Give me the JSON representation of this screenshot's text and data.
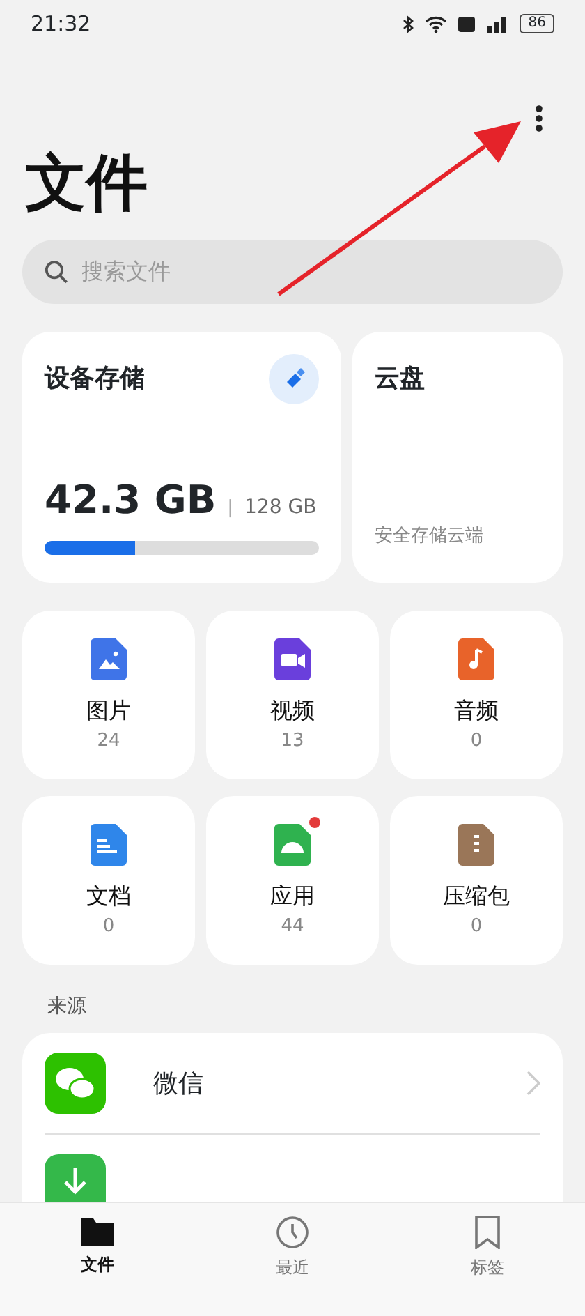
{
  "status_bar": {
    "time": "21:32",
    "battery": "86"
  },
  "title": "文件",
  "search": {
    "placeholder": "搜索文件"
  },
  "storage": {
    "title": "设备存储",
    "used": "42.3 GB",
    "separator": "|",
    "total": "128 GB",
    "level": 0.33
  },
  "cloud": {
    "title": "云盘",
    "subtitle": "安全存储云端"
  },
  "categories": [
    {
      "label": "图片",
      "count": "24",
      "kind": "image",
      "color": "#3f74e8"
    },
    {
      "label": "视频",
      "count": "13",
      "kind": "video",
      "color": "#6a3fdc"
    },
    {
      "label": "音频",
      "count": "0",
      "kind": "audio",
      "color": "#e8632a"
    },
    {
      "label": "文档",
      "count": "0",
      "kind": "document",
      "color": "#2f86ea"
    },
    {
      "label": "应用",
      "count": "44",
      "kind": "app",
      "color": "#2fb24f",
      "badge": true
    },
    {
      "label": "压缩包",
      "count": "0",
      "kind": "archive",
      "color": "#9a7658"
    }
  ],
  "sources_heading": "来源",
  "sources": [
    {
      "label": "微信",
      "kind": "chat"
    },
    {
      "kind": "download"
    }
  ],
  "tabs": [
    {
      "label": "文件",
      "kind": "files",
      "selected": true
    },
    {
      "label": "最近",
      "kind": "recent",
      "selected": false
    },
    {
      "label": "标签",
      "kind": "tags",
      "selected": false
    }
  ]
}
